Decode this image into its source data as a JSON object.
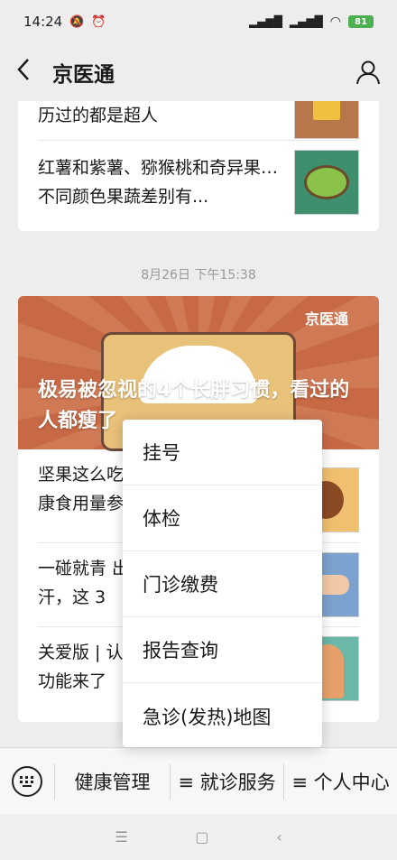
{
  "status": {
    "time": "14:24",
    "battery": "81"
  },
  "nav": {
    "title": "京医通",
    "back_icon": "chevron-left-icon",
    "account_icon": "person-icon"
  },
  "articles_top": [
    {
      "title": "历过的都是超人"
    },
    {
      "title": "红薯和紫薯、猕猴桃和奇异果…不同颜色果蔬差别有..."
    }
  ],
  "timestamp": "8月26日 下午15:38",
  "feature": {
    "logo": "京医通",
    "title": "极易被忽视的4个长胖习惯，看过的人都瘦了"
  },
  "articles_bottom": [
    {
      "title": "坚果这么吃 康食用量参"
    },
    {
      "title": "一碰就青 出汗，这 3"
    },
    {
      "title": "关爱版 | 认 的功能来了"
    }
  ],
  "popup_menu": {
    "items": [
      "挂号",
      "体检",
      "门诊缴费",
      "报告查询",
      "急诊(发热)地图"
    ]
  },
  "bottom_menu": {
    "items": [
      "健康管理",
      "≡ 就诊服务",
      "≡ 个人中心"
    ],
    "keyboard_icon": "keyboard-icon"
  },
  "system_nav": {
    "menu_icon": "menu-icon",
    "home_icon": "home-icon",
    "back_icon": "back-icon"
  }
}
